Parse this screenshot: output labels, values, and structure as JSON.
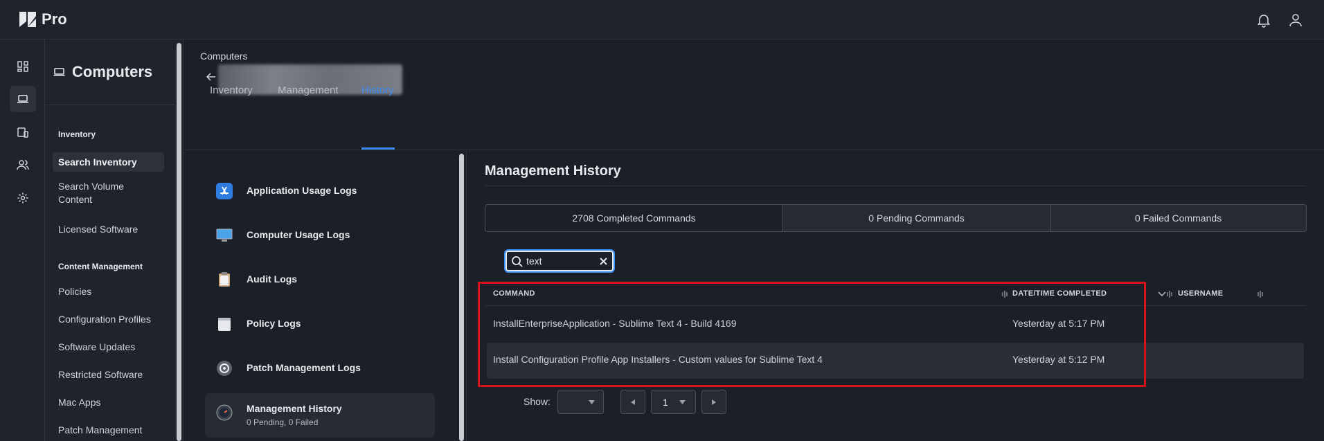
{
  "app": {
    "title": "Pro"
  },
  "sidebar": {
    "title": "Computers",
    "sections": [
      {
        "label": "Inventory",
        "items": [
          "Search Inventory",
          "Search Volume Content",
          "Licensed Software"
        ]
      },
      {
        "label": "Content Management",
        "items": [
          "Policies",
          "Configuration Profiles",
          "Software Updates",
          "Restricted Software",
          "Mac Apps",
          "Patch Management"
        ]
      }
    ]
  },
  "header": {
    "breadcrumb": "Computers",
    "tabs": [
      "Inventory",
      "Management",
      "History"
    ]
  },
  "history_list": [
    {
      "label": "Application Usage Logs",
      "sub": ""
    },
    {
      "label": "Computer Usage Logs",
      "sub": ""
    },
    {
      "label": "Audit Logs",
      "sub": ""
    },
    {
      "label": "Policy Logs",
      "sub": ""
    },
    {
      "label": "Patch Management Logs",
      "sub": ""
    },
    {
      "label": "Management History",
      "sub": "0 Pending, 0 Failed"
    }
  ],
  "panel": {
    "title": "Management History",
    "segments": [
      "2708 Completed Commands",
      "0 Pending Commands",
      "0 Failed Commands"
    ],
    "search_value": "text",
    "columns": [
      "COMMAND",
      "DATE/TIME COMPLETED",
      "USERNAME"
    ],
    "rows": [
      {
        "command": "InstallEnterpriseApplication - Sublime Text 4 - Build 4169",
        "completed": "Yesterday at 5:17 PM",
        "username": ""
      },
      {
        "command": "Install Configuration Profile App Installers - Custom values for Sublime Text 4",
        "completed": "Yesterday at 5:12 PM",
        "username": ""
      }
    ],
    "pager": {
      "show_label": "Show:",
      "page": "1"
    }
  },
  "colors": {
    "accent": "#3b8df0",
    "highlight": "#d4141a"
  }
}
